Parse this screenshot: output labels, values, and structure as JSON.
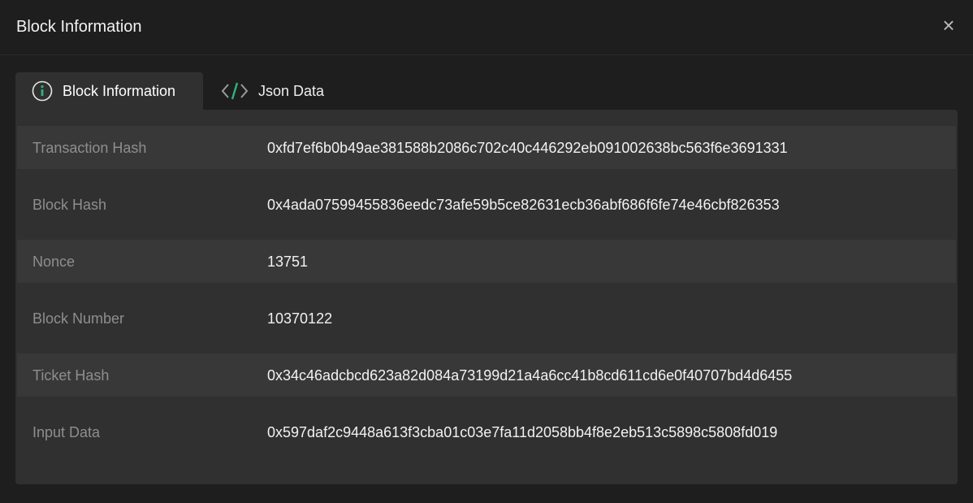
{
  "modal": {
    "title": "Block Information",
    "close_label": "×"
  },
  "tabs": [
    {
      "label": "Block Information",
      "icon": "info-circle-icon",
      "active": true
    },
    {
      "label": "Json Data",
      "icon": "code-icon",
      "active": false
    }
  ],
  "colors": {
    "accent_green": "#2fb37a",
    "background": "#1e1e1e",
    "panel": "#303030",
    "stripe": "#383838"
  },
  "fields": [
    {
      "label": "Transaction Hash",
      "value": "0xfd7ef6b0b49ae381588b2086c702c40c446292eb091002638bc563f6e3691331"
    },
    {
      "label": "Block Hash",
      "value": "0x4ada07599455836eedc73afe59b5ce82631ecb36abf686f6fe74e46cbf826353"
    },
    {
      "label": "Nonce",
      "value": "13751"
    },
    {
      "label": "Block Number",
      "value": "10370122"
    },
    {
      "label": "Ticket Hash",
      "value": "0x34c46adcbcd623a82d084a73199d21a4a6cc41b8cd611cd6e0f40707bd4d6455"
    },
    {
      "label": "Input Data",
      "value": "0x597daf2c9448a613f3cba01c03e7fa11d2058bb4f8e2eb513c5898c5808fd019"
    }
  ]
}
